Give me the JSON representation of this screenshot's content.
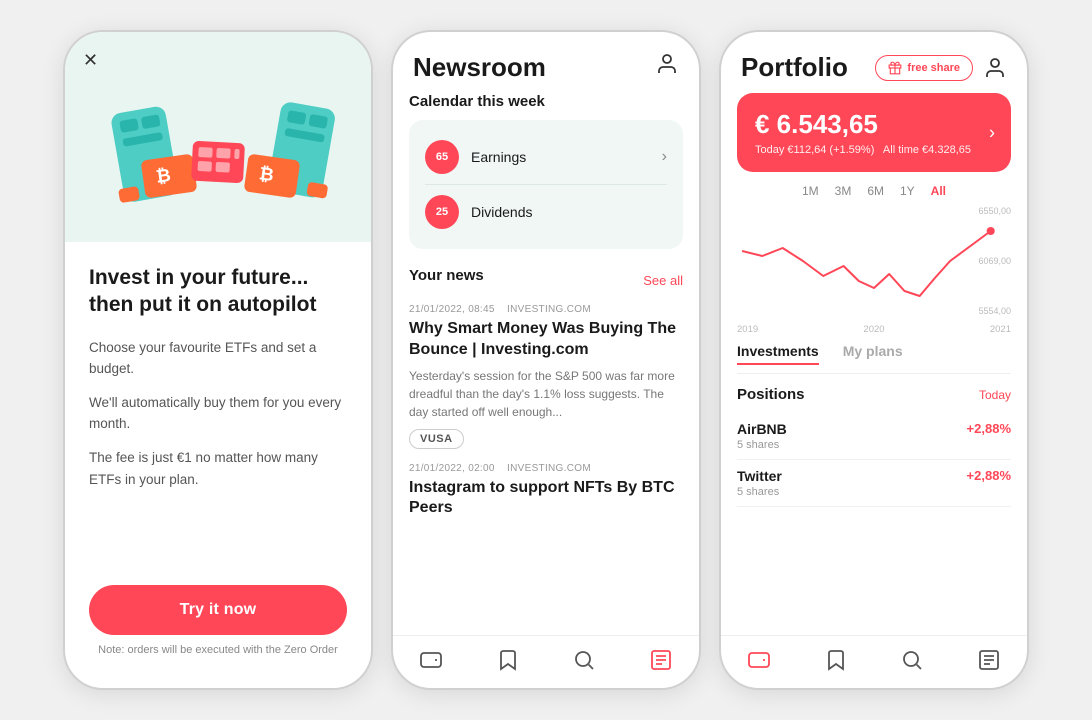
{
  "phone1": {
    "close_label": "✕",
    "title": "Invest in your future... then put it on autopilot",
    "desc1": "Choose your favourite ETFs and set a budget.",
    "desc2": "We'll automatically buy them for you every month.",
    "desc3": "The fee is just €1 no matter how many ETFs in your plan.",
    "cta_label": "Try it now",
    "note": "Note: orders will be executed with the Zero Order"
  },
  "phone2": {
    "user_icon": "👤",
    "title": "Newsroom",
    "calendar_label": "Calendar this week",
    "calendar_items": [
      {
        "badge": "65",
        "text": "Earnings",
        "has_arrow": true
      },
      {
        "badge": "25",
        "text": "Dividends",
        "has_arrow": false
      }
    ],
    "your_news_label": "Your news",
    "see_all_label": "See all",
    "news": [
      {
        "meta": "21/01/2022, 08:45    INVESTING.COM",
        "title": "Why Smart Money Was Buying The Bounce | Investing.com",
        "excerpt": "Yesterday's session for the S&P 500 was far more dreadful than the day's 1.1% loss suggests. The day started off well enough...",
        "tag": "VUSA"
      },
      {
        "meta": "21/01/2022, 02:00    INVESTING.COM",
        "title": "Instagram to support NFTs By BTC Peers",
        "excerpt": "",
        "tag": ""
      }
    ],
    "nav": [
      {
        "name": "wallet",
        "active": false
      },
      {
        "name": "bookmark",
        "active": false
      },
      {
        "name": "search",
        "active": false
      },
      {
        "name": "news",
        "active": true
      }
    ]
  },
  "phone3": {
    "user_icon": "👤",
    "title": "Portfolio",
    "free_share_label": "free share",
    "portfolio_amount": "€ 6.543,65",
    "portfolio_today": "Today €112,64 (+1.59%)",
    "portfolio_alltime": "All time €4.328,65",
    "time_filters": [
      "1M",
      "3M",
      "6M",
      "1Y",
      "All"
    ],
    "active_filter": "All",
    "chart_y_labels": [
      "6550,00",
      "6069,00",
      "5554,00"
    ],
    "chart_x_labels": [
      "2019",
      "2020",
      "2021"
    ],
    "tabs": [
      "Investments",
      "My plans"
    ],
    "active_tab": "Investments",
    "positions_label": "Positions",
    "today_label": "Today",
    "positions": [
      {
        "name": "AirBNB",
        "shares": "5 shares",
        "change": "+2,88%"
      },
      {
        "name": "Twitter",
        "shares": "5 shares",
        "change": "+2,88%"
      }
    ],
    "nav": [
      {
        "name": "wallet",
        "active": true
      },
      {
        "name": "bookmark",
        "active": false
      },
      {
        "name": "search",
        "active": false
      },
      {
        "name": "news",
        "active": false
      }
    ]
  }
}
